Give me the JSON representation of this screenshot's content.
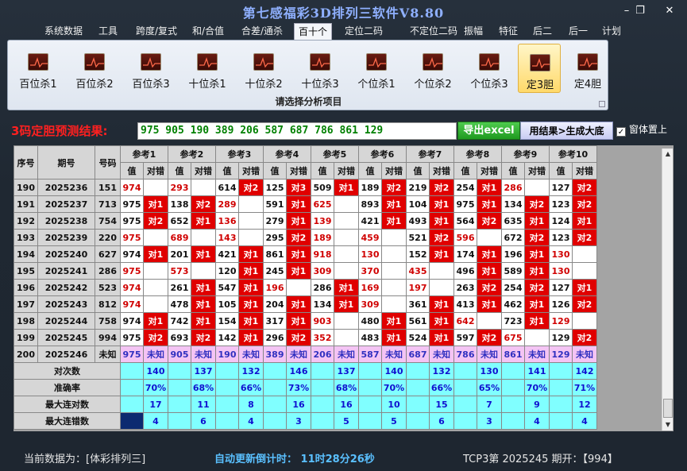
{
  "window": {
    "title": "第七感福彩3D排列三软件V8.80",
    "min": "–",
    "max": "❐",
    "close": "✕"
  },
  "menu": [
    "系统数据",
    "工具",
    "跨度/复式",
    "和/合值",
    "合差/通杀",
    "百十个",
    "定位二码",
    "不定位二码",
    "振幅",
    "特征",
    "后二",
    "后一",
    "计划"
  ],
  "menu_active": 5,
  "ribbon": {
    "buttons": [
      "百位杀1",
      "百位杀2",
      "百位杀3",
      "十位杀1",
      "十位杀2",
      "十位杀3",
      "个位杀1",
      "个位杀2",
      "个位杀3",
      "定3胆",
      "定4胆"
    ],
    "active": 9,
    "caption": "请选择分析项目",
    "corner": "⌟"
  },
  "result": {
    "label": "3码定胆预测结果:",
    "value": "975 905 190 389 206 587 687 786 861 129",
    "excel_button": "导出excel",
    "generate_button": "用结果>生成大底",
    "ontop_label": "窗体置上",
    "ontop_checked": "✓"
  },
  "grid": {
    "headers": {
      "seq": "序号",
      "period": "期号",
      "number": "号码",
      "value": "值",
      "hit": "对错"
    },
    "refs": [
      "参考1",
      "参考2",
      "参考3",
      "参考4",
      "参考5",
      "参考6",
      "参考7",
      "参考8",
      "参考9",
      "参考10"
    ],
    "rows": [
      {
        "seq": "190",
        "period": "2025236",
        "num": "151",
        "vals": [
          "974",
          "293",
          "614",
          "125",
          "509",
          "189",
          "219",
          "254",
          "286",
          "127"
        ],
        "hits": [
          "",
          "",
          "对2",
          "对3",
          "对1",
          "对2",
          "对2",
          "对1",
          "",
          "对2"
        ],
        "red": [
          1,
          1,
          0,
          0,
          0,
          0,
          0,
          0,
          1,
          0
        ]
      },
      {
        "seq": "191",
        "period": "2025237",
        "num": "713",
        "vals": [
          "975",
          "138",
          "289",
          "591",
          "625",
          "893",
          "104",
          "975",
          "134",
          "123"
        ],
        "hits": [
          "对1",
          "对2",
          "",
          "对1",
          "",
          "对1",
          "对1",
          "对1",
          "对2",
          "对2"
        ],
        "red": [
          0,
          0,
          1,
          0,
          1,
          0,
          0,
          0,
          0,
          0
        ]
      },
      {
        "seq": "192",
        "period": "2025238",
        "num": "754",
        "vals": [
          "975",
          "652",
          "136",
          "279",
          "139",
          "421",
          "493",
          "564",
          "635",
          "124"
        ],
        "hits": [
          "对2",
          "对1",
          "",
          "对1",
          "",
          "对1",
          "对1",
          "对2",
          "对1",
          "对1"
        ],
        "red": [
          0,
          0,
          1,
          0,
          1,
          0,
          0,
          0,
          0,
          0
        ]
      },
      {
        "seq": "193",
        "period": "2025239",
        "num": "220",
        "vals": [
          "975",
          "689",
          "143",
          "295",
          "189",
          "459",
          "521",
          "596",
          "672",
          "123"
        ],
        "hits": [
          "",
          "",
          "",
          "对2",
          "",
          "",
          "对2",
          "",
          "对2",
          "对2"
        ],
        "red": [
          1,
          1,
          1,
          0,
          1,
          1,
          0,
          1,
          0,
          0
        ]
      },
      {
        "seq": "194",
        "period": "2025240",
        "num": "627",
        "vals": [
          "974",
          "201",
          "421",
          "861",
          "918",
          "130",
          "152",
          "174",
          "196",
          "130"
        ],
        "hits": [
          "对1",
          "对1",
          "对1",
          "对1",
          "",
          "",
          "对1",
          "对1",
          "对1",
          ""
        ],
        "red": [
          0,
          0,
          0,
          0,
          1,
          1,
          0,
          0,
          0,
          1
        ]
      },
      {
        "seq": "195",
        "period": "2025241",
        "num": "286",
        "vals": [
          "975",
          "573",
          "120",
          "245",
          "309",
          "370",
          "435",
          "496",
          "589",
          "130"
        ],
        "hits": [
          "",
          "",
          "对1",
          "对1",
          "",
          "",
          "",
          "对1",
          "对1",
          ""
        ],
        "red": [
          1,
          1,
          0,
          0,
          1,
          1,
          1,
          0,
          0,
          1
        ]
      },
      {
        "seq": "196",
        "period": "2025242",
        "num": "523",
        "vals": [
          "974",
          "261",
          "547",
          "196",
          "286",
          "169",
          "197",
          "263",
          "254",
          "127"
        ],
        "hits": [
          "",
          "对1",
          "对1",
          "",
          "对1",
          "",
          "",
          "对2",
          "对2",
          "对1"
        ],
        "red": [
          1,
          0,
          0,
          1,
          0,
          1,
          1,
          0,
          0,
          0
        ]
      },
      {
        "seq": "197",
        "period": "2025243",
        "num": "812",
        "vals": [
          "974",
          "478",
          "105",
          "204",
          "134",
          "309",
          "361",
          "413",
          "462",
          "126"
        ],
        "hits": [
          "",
          "对1",
          "对1",
          "对1",
          "对1",
          "",
          "对1",
          "对1",
          "对1",
          "对2"
        ],
        "red": [
          1,
          0,
          0,
          0,
          0,
          1,
          0,
          0,
          0,
          0
        ]
      },
      {
        "seq": "198",
        "period": "2025244",
        "num": "758",
        "vals": [
          "974",
          "742",
          "154",
          "317",
          "903",
          "480",
          "561",
          "642",
          "723",
          "129"
        ],
        "hits": [
          "对1",
          "对1",
          "对1",
          "对1",
          "",
          "对1",
          "对1",
          "",
          "对1",
          ""
        ],
        "red": [
          0,
          0,
          0,
          0,
          1,
          0,
          0,
          1,
          0,
          1
        ]
      },
      {
        "seq": "199",
        "period": "2025245",
        "num": "994",
        "vals": [
          "975",
          "693",
          "142",
          "296",
          "352",
          "483",
          "524",
          "597",
          "675",
          "129"
        ],
        "hits": [
          "对2",
          "对2",
          "对1",
          "对2",
          "",
          "对1",
          "对1",
          "对2",
          "",
          "对2"
        ],
        "red": [
          0,
          0,
          0,
          0,
          1,
          0,
          0,
          0,
          1,
          0
        ]
      }
    ],
    "pending": {
      "seq": "200",
      "period": "2025246",
      "num": "未知",
      "vals": [
        "975",
        "905",
        "190",
        "389",
        "206",
        "587",
        "687",
        "786",
        "861",
        "129"
      ],
      "hit_label": "未知"
    },
    "summary": [
      {
        "label": "对次数",
        "vals": [
          "140",
          "137",
          "132",
          "146",
          "137",
          "140",
          "132",
          "130",
          "141",
          "142"
        ]
      },
      {
        "label": "准确率",
        "vals": [
          "70%",
          "68%",
          "66%",
          "73%",
          "68%",
          "70%",
          "66%",
          "65%",
          "70%",
          "71%"
        ]
      },
      {
        "label": "最大连对数",
        "vals": [
          "17",
          "11",
          "8",
          "16",
          "16",
          "10",
          "15",
          "7",
          "9",
          "12"
        ]
      },
      {
        "label": "最大连错数",
        "vals": [
          "4",
          "6",
          "4",
          "3",
          "5",
          "5",
          "6",
          "3",
          "4",
          "4"
        ]
      }
    ]
  },
  "scrollbar": {
    "up": "▲",
    "down": "▼"
  },
  "status": {
    "data_source": "当前数据为：[体彩排列三]",
    "countdown": "自动更新倒计时：  11时28分26秒",
    "draw": "TCP3第 2025245 期开：【994】"
  },
  "colors": {
    "hit": "#e00000",
    "unknown": "#f4c4f4",
    "summary": "#80ffff",
    "title": "#8fb0ff"
  }
}
